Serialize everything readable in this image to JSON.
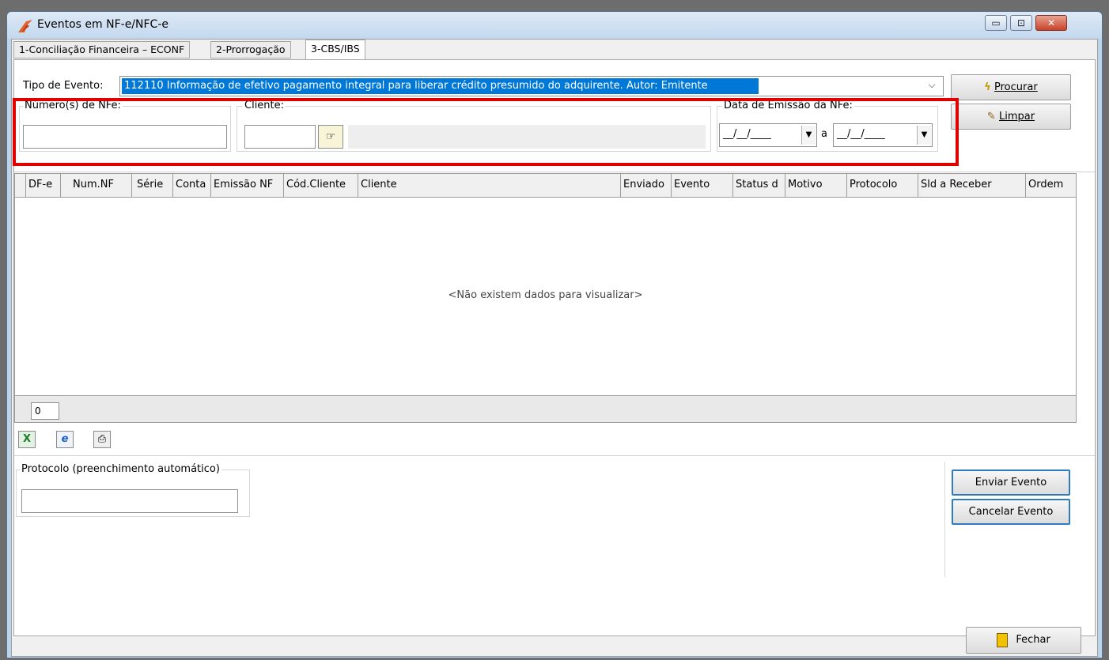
{
  "window": {
    "title": "Eventos em NF-e/NFC-e",
    "minimize": "▭",
    "maximize": "⊡",
    "close": "✕"
  },
  "tabs": [
    "1-Conciliação Financeira – ECONF",
    "2-Prorrogação",
    "3-CBS/IBS"
  ],
  "filters": {
    "tipo_evento_label": "Tipo de Evento:",
    "tipo_evento_value": "112110 Informação de efetivo pagamento integral para liberar crédito presumido do adquirente. Autor: Emitente",
    "numeros_label": "Número(s) de NFe:",
    "cliente_label": "Cliente:",
    "data_label": "Data de Emissão da NFe:",
    "date_from": "__/__/____",
    "date_to": "__/__/____",
    "date_separator": "a"
  },
  "buttons": {
    "procurar": "Procurar",
    "limpar": "Limpar",
    "enviar": "Enviar Evento",
    "cancelar": "Cancelar Evento",
    "fechar": "Fechar"
  },
  "grid": {
    "columns": [
      "DF-e",
      "Num.NF",
      "Série",
      "Conta",
      "Emissão NF",
      "Cód.Cliente",
      "Cliente",
      "Enviado",
      "Evento",
      "Status d",
      "Motivo",
      "Protocolo",
      "Sld a Receber",
      "Ordem"
    ],
    "empty_message": "<Não existem dados para visualizar>",
    "count": "0"
  },
  "toolbar": {
    "excel_icon": "excel-icon",
    "ie_icon": "internet-explorer-icon",
    "print_icon": "print-icon"
  },
  "protocolo": {
    "label": "Protocolo (preenchimento automático)",
    "value": ""
  },
  "colors": {
    "highlight": "#e00000",
    "selection": "#0078d7"
  }
}
